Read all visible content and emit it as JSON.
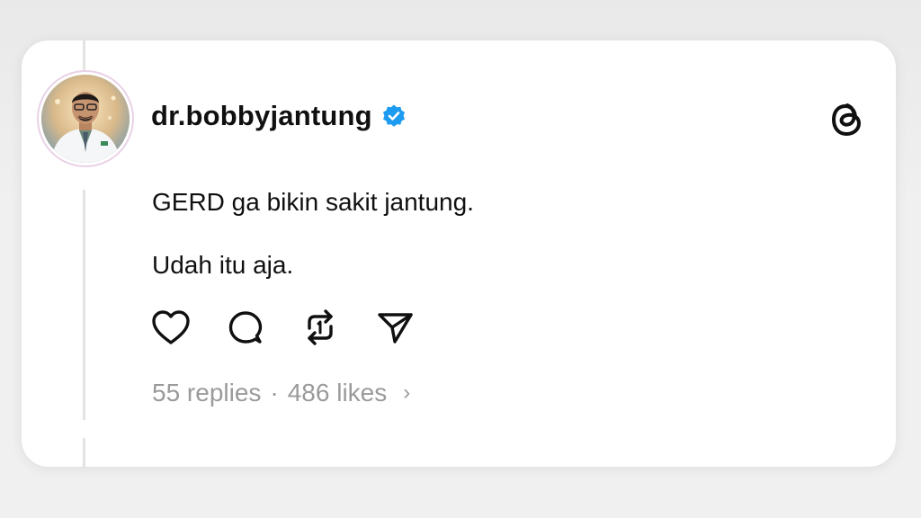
{
  "post": {
    "username": "dr.bobbyjantung",
    "verified": true,
    "text_lines": [
      "GERD ga bikin sakit jantung.",
      "Udah itu aja."
    ],
    "replies_label": "55 replies",
    "separator": "·",
    "likes_label": "486 likes",
    "chevron": "›"
  },
  "icons": {
    "verified": "verified-badge-icon",
    "brand": "threads-logo-icon",
    "like": "heart-icon",
    "reply": "comment-bubble-icon",
    "repost": "repost-icon",
    "share": "send-icon"
  },
  "colors": {
    "verified_blue": "#1d9bf0",
    "text": "#101010",
    "muted": "#9a9a9a",
    "thread_line": "#e3e3e3"
  }
}
